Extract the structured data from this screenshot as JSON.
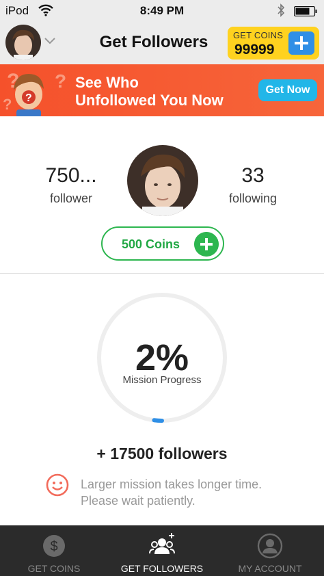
{
  "status_bar": {
    "carrier": "iPod",
    "time": "8:49 PM"
  },
  "nav": {
    "title": "Get Followers",
    "coins_label": "GET COINS",
    "coins_value": "99999"
  },
  "banner": {
    "line1": "See Who",
    "line2": "Unfollowed You Now",
    "button": "Get Now"
  },
  "profile": {
    "followers_count": "750...",
    "followers_label": "follower",
    "following_count": "33",
    "following_label": "following",
    "coins_pill": "500 Coins"
  },
  "mission": {
    "progress_text": "2%",
    "progress_value": 0.02,
    "progress_label": "Mission Progress",
    "followers_goal": "+ 17500 followers",
    "note_line1": "Larger mission takes longer time.",
    "note_line2": "Please wait patiently."
  },
  "tabs": [
    {
      "label": "GET COINS",
      "icon": "dollar-icon",
      "active": false
    },
    {
      "label": "GET FOLLOWERS",
      "icon": "followers-icon",
      "active": true
    },
    {
      "label": "MY ACCOUNT",
      "icon": "account-icon",
      "active": false
    }
  ],
  "colors": {
    "coins_yellow": "#ffd21f",
    "accent_blue": "#2f8fe6",
    "banner_orange": "#f5512b",
    "green": "#2db64f",
    "progress_blue": "#2f8fe6",
    "tab_bar": "#2b2b2b"
  }
}
